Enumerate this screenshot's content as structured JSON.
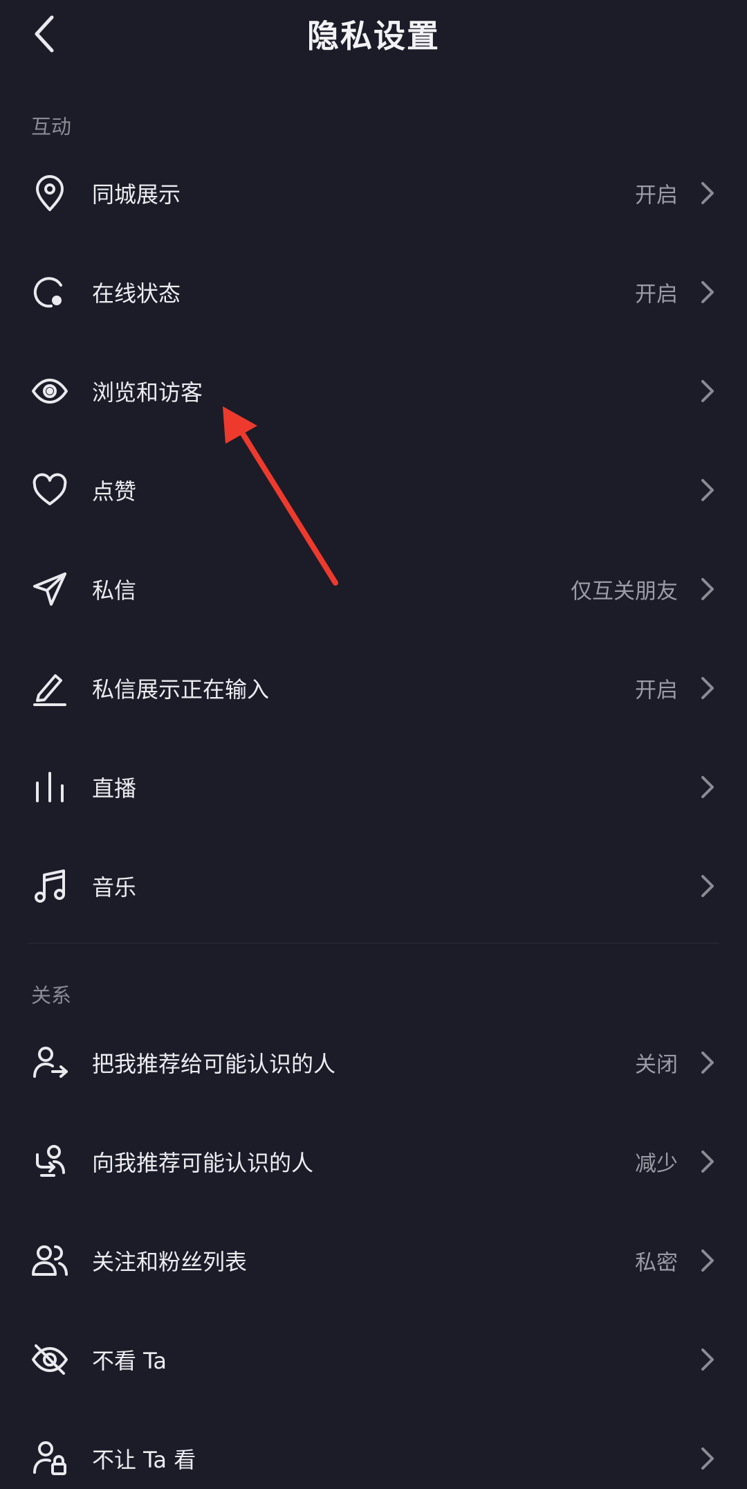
{
  "header": {
    "title": "隐私设置"
  },
  "sections": {
    "interaction": {
      "label": "互动",
      "items": [
        {
          "label": "同城展示",
          "value": "开启",
          "icon": "location-pin-icon"
        },
        {
          "label": "在线状态",
          "value": "开启",
          "icon": "online-status-icon"
        },
        {
          "label": "浏览和访客",
          "value": "",
          "icon": "eye-icon"
        },
        {
          "label": "点赞",
          "value": "",
          "icon": "heart-icon"
        },
        {
          "label": "私信",
          "value": "仅互关朋友",
          "icon": "send-icon"
        },
        {
          "label": "私信展示正在输入",
          "value": "开启",
          "icon": "pen-icon"
        },
        {
          "label": "直播",
          "value": "",
          "icon": "live-bars-icon"
        },
        {
          "label": "音乐",
          "value": "",
          "icon": "music-note-icon"
        }
      ]
    },
    "relations": {
      "label": "关系",
      "items": [
        {
          "label": "把我推荐给可能认识的人",
          "value": "关闭",
          "icon": "user-share-icon"
        },
        {
          "label": "向我推荐可能认识的人",
          "value": "减少",
          "icon": "user-recommend-icon"
        },
        {
          "label": "关注和粉丝列表",
          "value": "私密",
          "icon": "users-icon"
        },
        {
          "label": "不看 Ta",
          "value": "",
          "icon": "eye-off-icon"
        },
        {
          "label": "不让 Ta 看",
          "value": "",
          "icon": "user-lock-icon"
        }
      ]
    }
  },
  "colors": {
    "background": "#1b1c28",
    "annotation_arrow": "#ee3a2c"
  }
}
